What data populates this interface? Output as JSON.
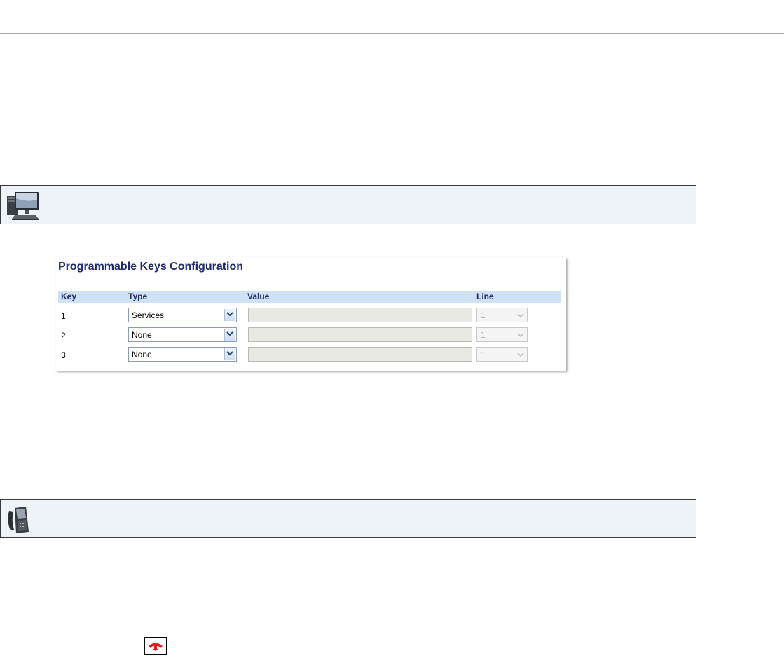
{
  "web_bar": {
    "icon": "computer-monitor-icon"
  },
  "phone_bar": {
    "icon": "desk-phone-icon"
  },
  "panel": {
    "title": "Programmable Keys Configuration",
    "headers": {
      "key": "Key",
      "type": "Type",
      "value": "Value",
      "line": "Line"
    },
    "rows": [
      {
        "key": "1",
        "type": "Services",
        "value": "",
        "line": "1"
      },
      {
        "key": "2",
        "type": "None",
        "value": "",
        "line": "1"
      },
      {
        "key": "3",
        "type": "None",
        "value": "",
        "line": "1"
      }
    ]
  },
  "hangup_key": {
    "icon": "hang-up-handset-icon",
    "color": "#e0201c"
  }
}
